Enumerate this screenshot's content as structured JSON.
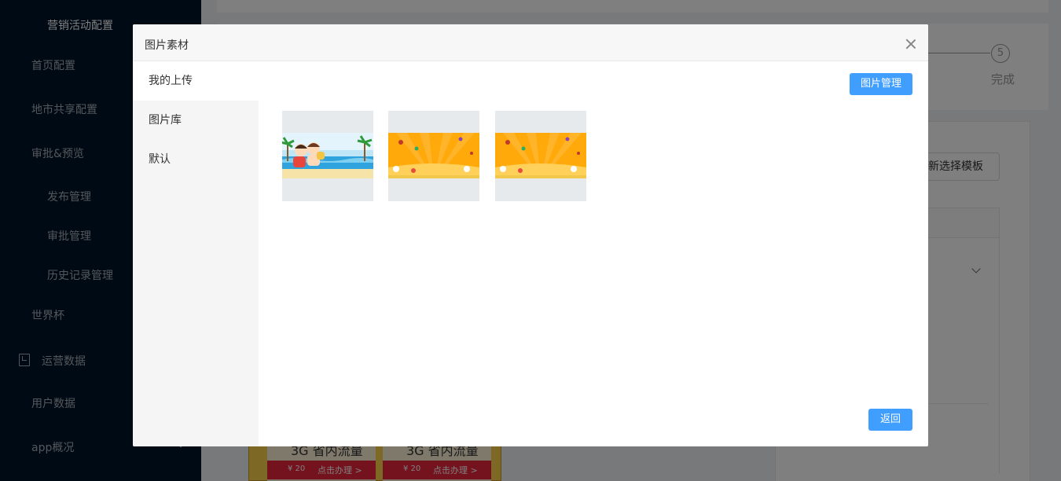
{
  "sidebar": {
    "items": [
      {
        "label": "营销活动配置"
      },
      {
        "label": "首页配置"
      },
      {
        "label": "地市共享配置"
      },
      {
        "label": "审批&预览"
      },
      {
        "label": "发布管理"
      },
      {
        "label": "审批管理"
      },
      {
        "label": "历史记录管理"
      },
      {
        "label": "世界杯"
      },
      {
        "label": "运营数据"
      },
      {
        "label": "用户数据"
      },
      {
        "label": "app概况"
      }
    ]
  },
  "background": {
    "step_number": "5",
    "step_label": "完成",
    "template_button": "新选择模板",
    "preview": {
      "coupon_title": "3G 省内流量",
      "price": "¥ 20",
      "action": "点击办理 >"
    }
  },
  "modal": {
    "title": "图片素材",
    "nav": [
      {
        "label": "我的上传"
      },
      {
        "label": "图片库"
      },
      {
        "label": "默认"
      }
    ],
    "manage_button": "图片管理",
    "back_button": "返回",
    "images": [
      {
        "theme": "beach-cartoon-banner"
      },
      {
        "theme": "orange-sunburst-banner"
      },
      {
        "theme": "orange-sunburst-banner"
      }
    ]
  },
  "colors": {
    "sidebar_bg": "#001529",
    "primary": "#409eff",
    "overlay": "rgba(0,0,0,0.5)"
  }
}
